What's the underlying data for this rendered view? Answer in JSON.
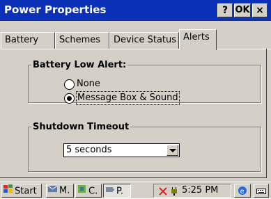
{
  "window": {
    "title": "Power Properties",
    "help_label": "?",
    "ok_label": "OK",
    "close_label": "×"
  },
  "tabs": [
    {
      "label": "Battery"
    },
    {
      "label": "Schemes"
    },
    {
      "label": "Device Status"
    },
    {
      "label": "Alerts",
      "active": true
    }
  ],
  "battery_low_alert": {
    "legend": "Battery Low Alert:",
    "options": [
      {
        "label": "None",
        "checked": false
      },
      {
        "label": "Message Box & Sound",
        "checked": true
      }
    ]
  },
  "shutdown_timeout": {
    "legend": "Shutdown Timeout",
    "selected": "5 seconds"
  },
  "taskbar": {
    "start_label": "Start",
    "apps": [
      {
        "label": "M."
      },
      {
        "label": "C."
      },
      {
        "label": "P."
      }
    ],
    "time": "5:25 PM"
  },
  "colors": {
    "title_bar": "#0a31b8",
    "dialog_bg": "#d4d0c8"
  }
}
